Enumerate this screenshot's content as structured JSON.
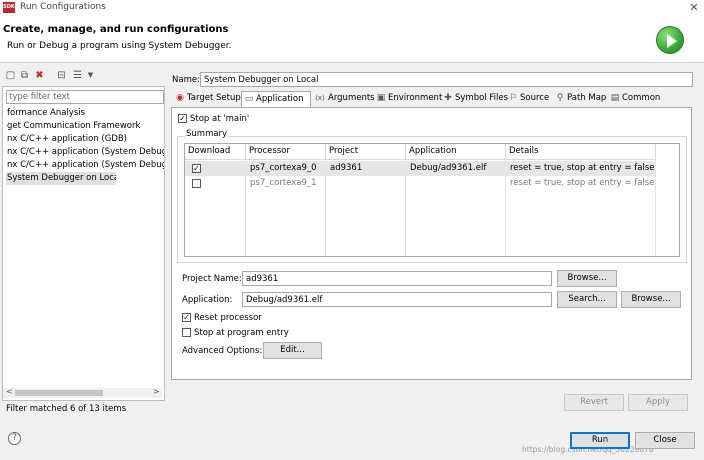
{
  "window": {
    "app_icon": "SDK",
    "title": "Run Configurations",
    "close_glyph": "✕"
  },
  "header": {
    "title": "Create, manage, and run configurations",
    "subtitle": "Run or Debug a program using System Debugger.",
    "run_icon": "run-icon"
  },
  "left": {
    "toolbar_icons": [
      "new-config-icon",
      "duplicate-icon",
      "delete-icon",
      "collapse-all-icon",
      "filter-icon",
      "dropdown-icon"
    ],
    "filter_placeholder": "type filter text",
    "items": [
      {
        "label": "formance Analysis"
      },
      {
        "label": "get Communication Framework"
      },
      {
        "label": "nx C/C++ application (GDB)"
      },
      {
        "label": "nx C/C++ application (System Debugger"
      },
      {
        "label": "nx C/C++ application (System Debugger"
      },
      {
        "label": "System Debugger on Local",
        "selected": true
      }
    ],
    "status": "Filter matched 6 of 13 items",
    "scroll_left": "<",
    "scroll_right": ">"
  },
  "config": {
    "name_label": "Name:",
    "name_value": "System Debugger on Local",
    "tabs": [
      {
        "label": "Target Setup",
        "icon": "target-icon",
        "glyph": "◉"
      },
      {
        "label": "Application",
        "icon": "application-icon",
        "glyph": "▭",
        "active": true
      },
      {
        "label": "Arguments",
        "icon": "arguments-icon",
        "glyph": "(x)"
      },
      {
        "label": "Environment",
        "icon": "environment-icon",
        "glyph": "▣"
      },
      {
        "label": "Symbol Files",
        "icon": "symbol-files-icon",
        "glyph": "✚"
      },
      {
        "label": "Source",
        "icon": "source-icon",
        "glyph": "⚐"
      },
      {
        "label": "Path Map",
        "icon": "path-map-icon",
        "glyph": "⚲"
      },
      {
        "label": "Common",
        "icon": "common-icon",
        "glyph": "▤"
      }
    ],
    "stop_at_main": {
      "label": "Stop at 'main'",
      "checked": true
    },
    "summary": {
      "title": "Summary",
      "columns": [
        "Download",
        "Processor",
        "Project",
        "Application",
        "Details"
      ],
      "rows": [
        {
          "download": true,
          "processor": "ps7_cortexa9_0",
          "project": "ad9361",
          "application": "Debug/ad9361.elf",
          "details": "reset = true, stop at entry = false, ..."
        },
        {
          "download": false,
          "processor": "ps7_cortexa9_1",
          "project": "",
          "application": "",
          "details": "reset = true, stop at entry = false, ..."
        }
      ]
    },
    "project_name": {
      "label": "Project Name:",
      "value": "ad9361",
      "browse": "Browse..."
    },
    "application": {
      "label": "Application:",
      "value": "Debug/ad9361.elf",
      "search": "Search...",
      "browse": "Browse..."
    },
    "reset_processor": {
      "label": "Reset processor",
      "checked": true
    },
    "stop_at_entry": {
      "label": "Stop at program entry",
      "checked": false
    },
    "advanced": {
      "label": "Advanced Options:",
      "button": "Edit..."
    },
    "revert": "Revert",
    "apply": "Apply"
  },
  "footer": {
    "help": "?",
    "run": "Run",
    "close": "Close",
    "watermark": "https://blog.csdn.net/qq_36229876"
  }
}
